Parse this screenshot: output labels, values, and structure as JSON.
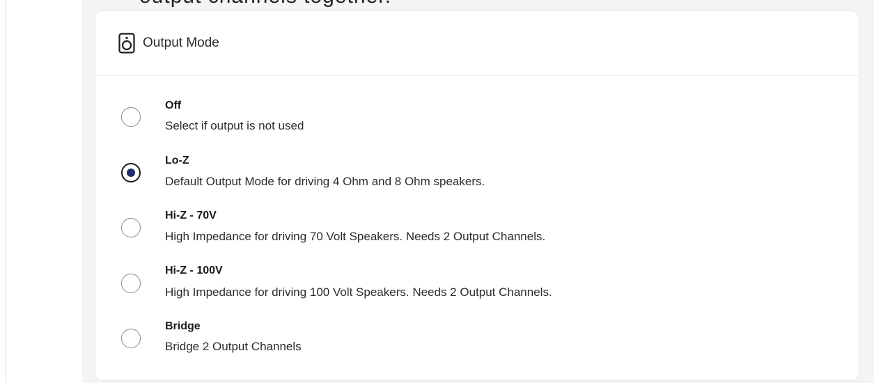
{
  "top_heading": "output channels together.",
  "card": {
    "title": "Output Mode",
    "icon": "speaker-icon"
  },
  "output_modes": [
    {
      "title": "Off",
      "description": "Select if output is not used",
      "selected": false
    },
    {
      "title": "Lo-Z",
      "description": "Default Output Mode for driving 4 Ohm and 8 Ohm speakers.",
      "selected": true
    },
    {
      "title": "Hi-Z - 70V",
      "description": "High Impedance for driving 70 Volt Speakers. Needs 2 Output Channels.",
      "selected": false
    },
    {
      "title": "Hi-Z - 100V",
      "description": "High Impedance for driving 100 Volt Speakers. Needs 2 Output Channels.",
      "selected": false
    },
    {
      "title": "Bridge",
      "description": "Bridge 2 Output Channels",
      "selected": false
    }
  ],
  "colors": {
    "radio_selected_dot": "#1e2d6b",
    "page_background": "#f3f4f6",
    "card_background": "#ffffff"
  }
}
